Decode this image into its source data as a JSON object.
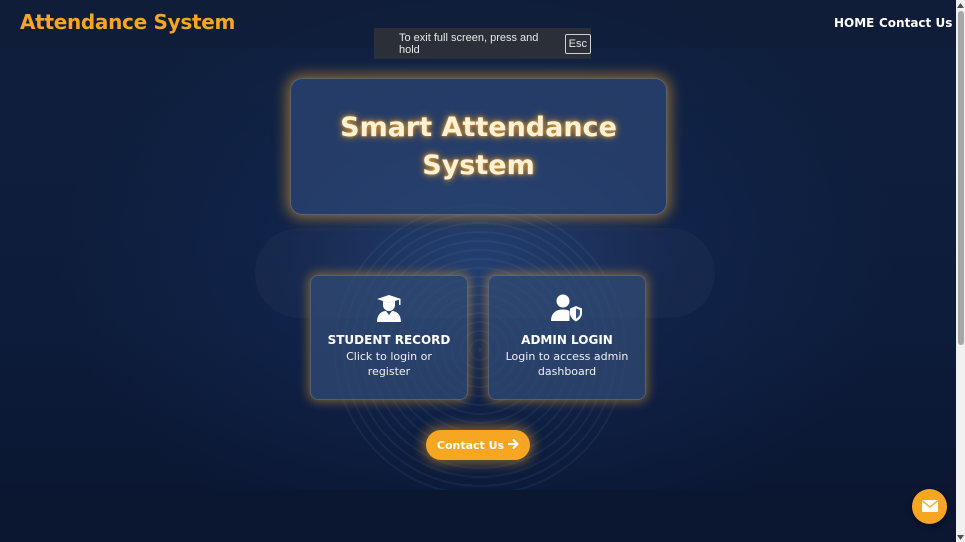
{
  "header": {
    "brand": "Attendance System",
    "nav": {
      "home": "HOME",
      "contact": "Contact Us"
    }
  },
  "fullscreen_notice": {
    "text": "To exit full screen, press and hold",
    "key": "Esc"
  },
  "hero": {
    "title": "Smart Attendance System"
  },
  "cards": [
    {
      "icon": "graduate-icon",
      "title": "STUDENT RECORD",
      "description": "Click to login or register"
    },
    {
      "icon": "admin-shield-icon",
      "title": "ADMIN LOGIN",
      "description": "Login to access admin dashboard"
    }
  ],
  "contact_button": {
    "label": "Contact Us",
    "icon": "arrow-right-icon"
  },
  "floating_button": {
    "icon": "mail-icon"
  },
  "colors": {
    "accent": "#f6a623",
    "background": "#0d1a33",
    "card": "#324b73"
  }
}
